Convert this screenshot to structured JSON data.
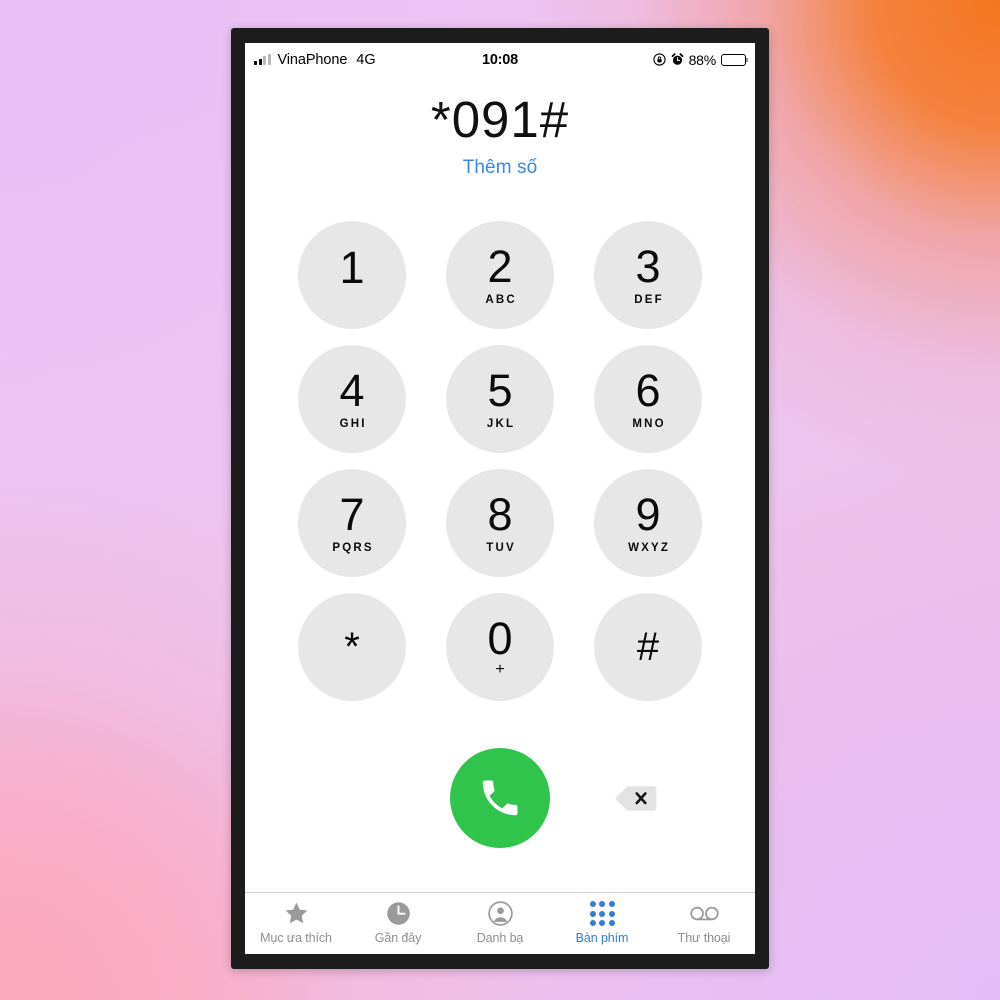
{
  "status_bar": {
    "carrier": "VinaPhone",
    "network": "4G",
    "time": "10:08",
    "battery_percent": "88%",
    "icons": [
      "rotation-lock-icon",
      "alarm-clock-icon",
      "battery-icon"
    ]
  },
  "display": {
    "dialed_number": "*091#",
    "add_number_label": "Thêm số",
    "add_number_color": "#3b8ae0"
  },
  "keypad": {
    "keys": [
      {
        "digit": "1",
        "letters": ""
      },
      {
        "digit": "2",
        "letters": "ABC"
      },
      {
        "digit": "3",
        "letters": "DEF"
      },
      {
        "digit": "4",
        "letters": "GHI"
      },
      {
        "digit": "5",
        "letters": "JKL"
      },
      {
        "digit": "6",
        "letters": "MNO"
      },
      {
        "digit": "7",
        "letters": "PQRS"
      },
      {
        "digit": "8",
        "letters": "TUV"
      },
      {
        "digit": "9",
        "letters": "WXYZ"
      },
      {
        "digit": "*",
        "letters": ""
      },
      {
        "digit": "0",
        "letters": "+"
      },
      {
        "digit": "#",
        "letters": ""
      }
    ],
    "key_background": "#e7e7e7"
  },
  "actions": {
    "call_button_icon": "phone-handset-icon",
    "call_button_color": "#31c44c",
    "delete_button_icon": "backspace-delete-icon"
  },
  "tab_bar": {
    "items": [
      {
        "label": "Mục ưa thích",
        "icon": "star-icon",
        "active": false
      },
      {
        "label": "Gần đây",
        "icon": "clock-icon",
        "active": false
      },
      {
        "label": "Danh bạ",
        "icon": "person-circle-icon",
        "active": false
      },
      {
        "label": "Bàn phím",
        "icon": "keypad-grid-icon",
        "active": true
      },
      {
        "label": "Thư thoại",
        "icon": "voicemail-icon",
        "active": false
      }
    ],
    "active_color": "#2f7fd6",
    "inactive_color": "#8e8e8e"
  }
}
